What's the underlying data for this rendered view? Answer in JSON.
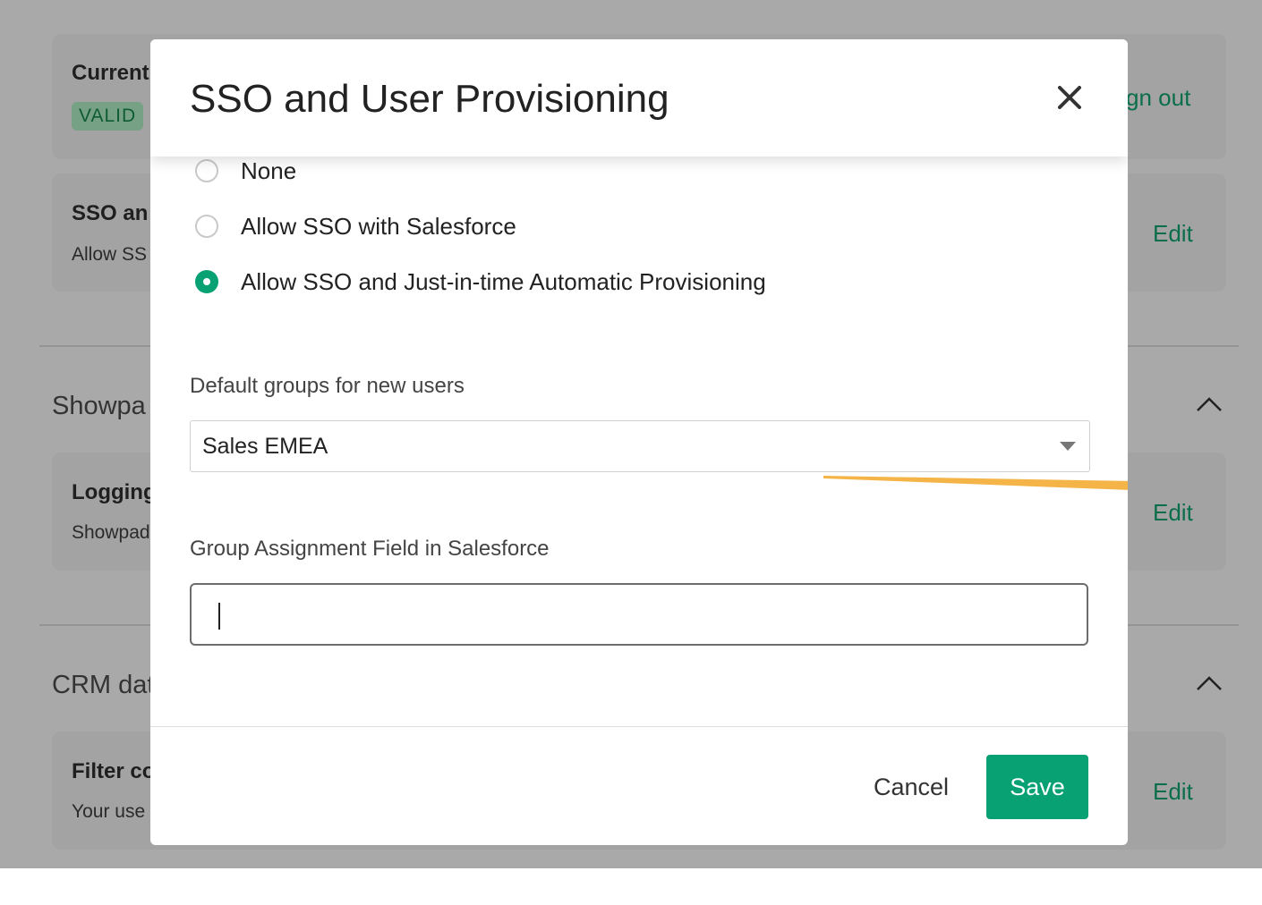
{
  "background": {
    "current_card": {
      "title": "Current",
      "badge": "VALID",
      "link": "gn out"
    },
    "sso_card": {
      "title": "SSO an",
      "description": "Allow SS",
      "link": "Edit"
    },
    "section_showpad": {
      "title": "Showpa"
    },
    "logging_card": {
      "title": "Logging",
      "description": "Showpad",
      "link": "Edit"
    },
    "section_crm": {
      "title": "CRM dat"
    },
    "filter_card": {
      "title": "Filter co",
      "description": "Your use",
      "link": "Edit"
    }
  },
  "modal": {
    "title": "SSO and User Provisioning",
    "sso_options": [
      {
        "label": "None",
        "selected": false
      },
      {
        "label": "Allow SSO with Salesforce",
        "selected": false
      },
      {
        "label": "Allow SSO and Just-in-time Automatic Provisioning",
        "selected": true
      }
    ],
    "default_groups": {
      "label": "Default groups for new users",
      "value": "Sales EMEA"
    },
    "group_field": {
      "label": "Group Assignment Field in Salesforce",
      "value": ""
    },
    "cancel_label": "Cancel",
    "save_label": "Save"
  },
  "colors": {
    "accent": "#07a174",
    "overlay": "#a9a9a9",
    "annotation_arrow": "#f5b447"
  },
  "icons": {
    "close": "close-icon",
    "select_caret": "caret-down-icon",
    "section_toggle": "chevron-up-icon"
  }
}
